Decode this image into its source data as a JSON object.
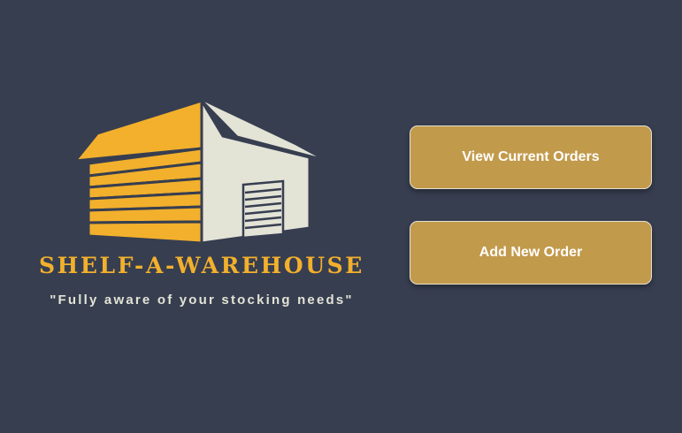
{
  "brand": {
    "name": "SHELF-A-WAREHOUSE",
    "tagline": "\"Fully aware of your stocking needs\""
  },
  "actions": {
    "view_orders_label": "View Current Orders",
    "add_order_label": "Add New Order"
  },
  "colors": {
    "background": "#373e50",
    "brand_gold": "#f2b02c",
    "button_fill": "#c29a4b",
    "warehouse_wall": "#e3e3d6"
  },
  "icons": {
    "logo": "warehouse-icon"
  }
}
